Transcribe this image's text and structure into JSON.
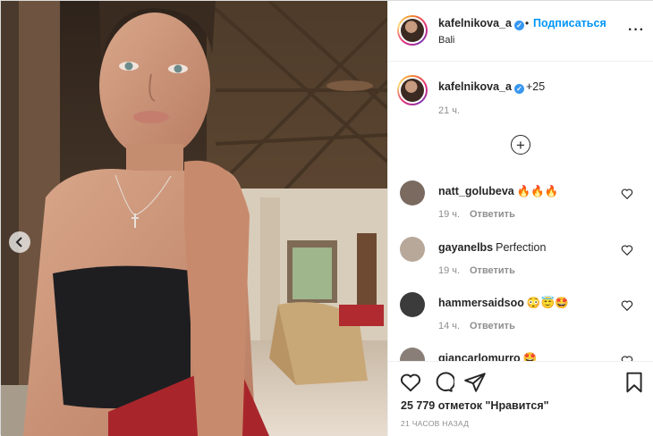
{
  "header": {
    "username": "kafelnikova_a",
    "verified_mark": "✓",
    "separator": "•",
    "follow_label": "Подписаться",
    "location": "Bali",
    "more_icon": "more-horizontal-icon"
  },
  "caption": {
    "username": "kafelnikova_a",
    "text": "+25",
    "time": "21 ч."
  },
  "load_more_symbol": "+",
  "comments": [
    {
      "username": "natt_golubeva",
      "text": "🔥🔥🔥",
      "time": "19 ч.",
      "reply": "Ответить",
      "avatar_color": "#7a6a60"
    },
    {
      "username": "gayanelbs",
      "text": "Perfection",
      "time": "19 ч.",
      "reply": "Ответить",
      "avatar_color": "#b8a89a"
    },
    {
      "username": "hammersaidsoo",
      "text": "😳😇🤩",
      "time": "14 ч.",
      "reply": "Ответить",
      "avatar_color": "#3b3b3b"
    },
    {
      "username": "giancarlomurro",
      "text": "🤩",
      "time": "",
      "reply": "",
      "avatar_color": "#8a7f78"
    }
  ],
  "footer": {
    "likes": "25 779 отметок \"Нравится\"",
    "time_ago": "21 ЧАСОВ НАЗАД"
  },
  "colors": {
    "accent": "#0095f6",
    "muted": "#8e8e8e",
    "text": "#262626"
  }
}
